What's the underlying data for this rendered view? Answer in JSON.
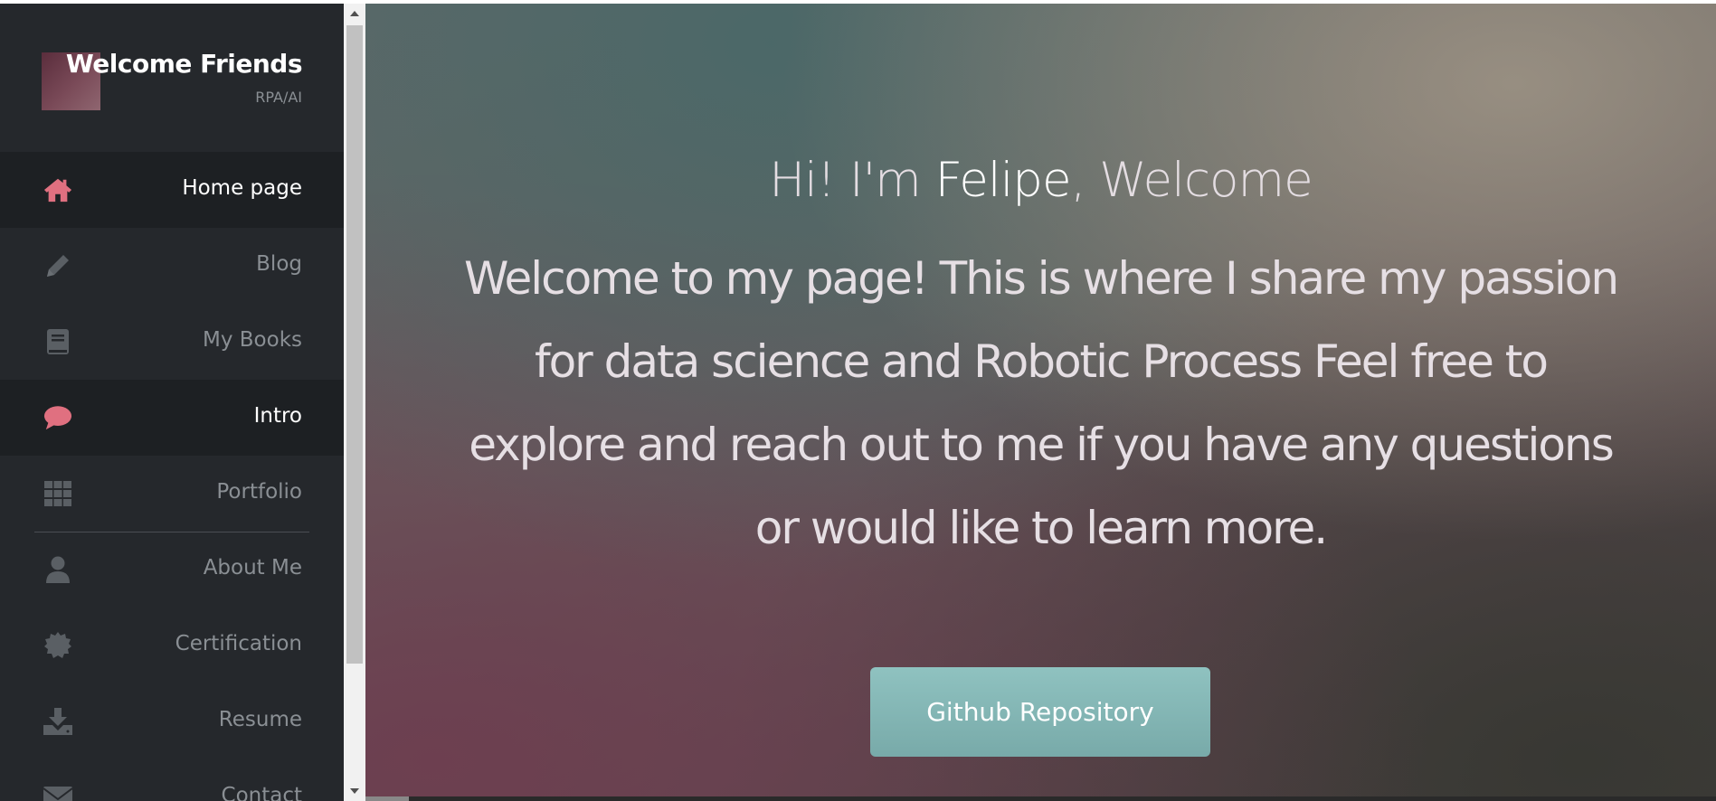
{
  "brand": {
    "title": "Welcome Friends",
    "subtitle": "RPA/AI"
  },
  "sidebar": {
    "items": [
      {
        "label": "Home page",
        "icon": "home-icon",
        "active": true
      },
      {
        "label": "Blog",
        "icon": "pencil-icon",
        "active": false
      },
      {
        "label": "My Books",
        "icon": "book-icon",
        "active": false
      },
      {
        "label": "Intro",
        "icon": "speech-bubble-icon",
        "active": true
      },
      {
        "label": "Portfolio",
        "icon": "grid-icon",
        "active": false
      },
      {
        "label": "About Me",
        "icon": "user-icon",
        "active": false
      },
      {
        "label": "Certification",
        "icon": "certificate-icon",
        "active": false
      },
      {
        "label": "Resume",
        "icon": "download-icon",
        "active": false
      },
      {
        "label": "Contact",
        "icon": "envelope-icon",
        "active": false
      }
    ]
  },
  "hero": {
    "greeting_prefix": "Hi! I'm ",
    "name": "Felipe",
    "greeting_suffix": ", Welcome",
    "text": "Welcome to my page! This is where I share my passion for data science and Robotic Process Feel free to explore and reach out to me if you have any questions or would like to learn more.",
    "button_label": "Github Repository"
  },
  "colors": {
    "sidebar_bg": "#25282c",
    "active_icon": "#e07080",
    "inactive_icon": "#5a5f64",
    "button": "#80b3b2"
  }
}
